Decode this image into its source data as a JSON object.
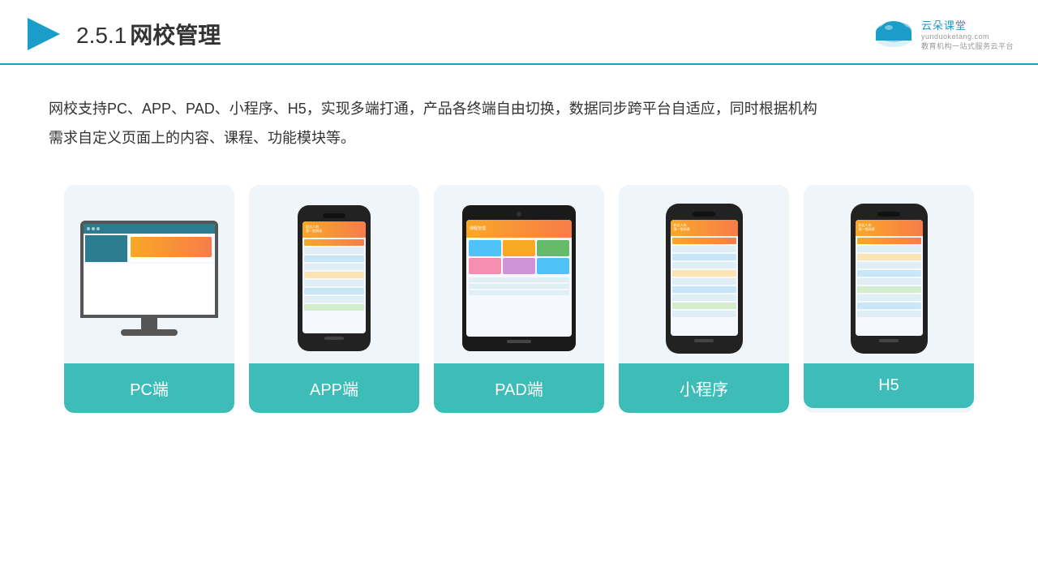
{
  "header": {
    "section_number": "2.5.1",
    "title": "网校管理",
    "logo_main": "云朵课堂",
    "logo_domain": "yunduoketang.com",
    "logo_tagline": "教育机构一站",
    "logo_tagline2": "式服务云平台"
  },
  "description": {
    "text": "网校支持PC、APP、PAD、小程序、H5，实现多端打通，产品各终端自由切换，数据同步跨平台自适应，同时根据机构",
    "text2": "需求自定义页面上的内容、课程、功能模块等。"
  },
  "cards": [
    {
      "id": "pc",
      "label": "PC端"
    },
    {
      "id": "app",
      "label": "APP端"
    },
    {
      "id": "pad",
      "label": "PAD端"
    },
    {
      "id": "miniprogram",
      "label": "小程序"
    },
    {
      "id": "h5",
      "label": "H5"
    }
  ]
}
